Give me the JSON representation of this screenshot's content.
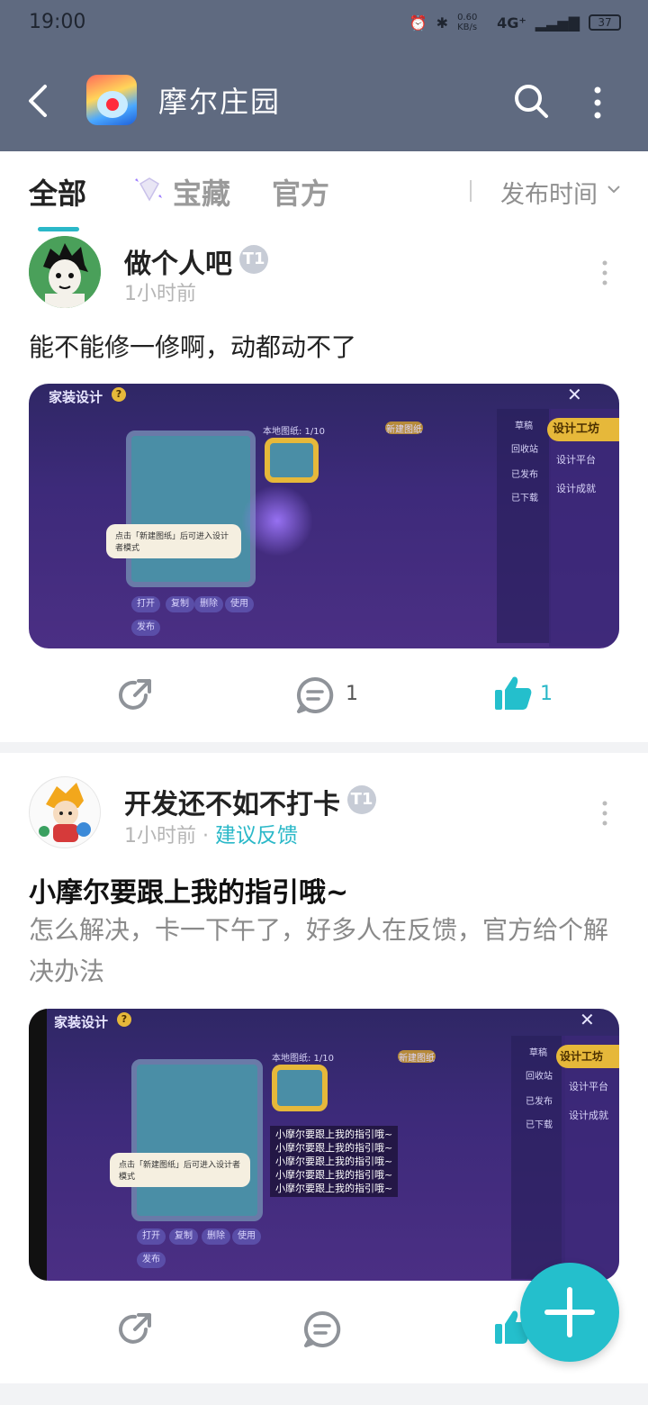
{
  "status_bar": {
    "time": "19:00",
    "net_speed": "0.60 KB/s",
    "signal": "4G⁺",
    "battery": "37"
  },
  "header": {
    "title": "摩尔庄园"
  },
  "tabs": {
    "all": "全部",
    "treasure": "宝藏",
    "official": "官方",
    "sort": "发布时间"
  },
  "posts": [
    {
      "user": "做个人吧",
      "badge": "T1",
      "time": "1小时前",
      "tag": "",
      "text": "能不能修一修啊，动都动不了",
      "image": {
        "title": "家装设计",
        "local_label": "本地图纸: 1/10",
        "new_label": "新建图纸",
        "tip": "点击「新建图纸」后可进入设计者模式",
        "side": [
          "草稿",
          "回收站",
          "已发布",
          "已下载"
        ],
        "menu": [
          "设计工坊",
          "设计平台",
          "设计成就"
        ],
        "buttons": [
          "打开",
          "复制",
          "删除",
          "使用",
          "发布"
        ],
        "spam": []
      },
      "comments": "1",
      "likes": "1"
    },
    {
      "user": "开发还不如不打卡",
      "badge": "T1",
      "time": "1小时前",
      "tag": "建议反馈",
      "title": "小摩尔要跟上我的指引哦~",
      "text": "怎么解决，卡一下午了，好多人在反馈，官方给个解决办法",
      "image": {
        "title": "家装设计",
        "local_label": "本地图纸: 1/10",
        "new_label": "新建图纸",
        "tip": "点击「新建图纸」后可进入设计者模式",
        "side": [
          "草稿",
          "回收站",
          "已发布",
          "已下载"
        ],
        "menu": [
          "设计工坊",
          "设计平台",
          "设计成就"
        ],
        "buttons": [
          "打开",
          "复制",
          "删除",
          "使用",
          "发布"
        ],
        "spam": [
          "小摩尔要跟上我的指引哦~",
          "小摩尔要跟上我的指引哦~",
          "小摩尔要跟上我的指引哦~",
          "小摩尔要跟上我的指引哦~",
          "小摩尔要跟上我的指引哦~"
        ]
      }
    }
  ],
  "colors": {
    "header_bg": "#5f6a80",
    "accent": "#2ab8c8",
    "fab": "#24bfcc"
  },
  "icons": [
    "back-arrow-icon",
    "search-icon",
    "more-vertical-icon",
    "diamond-icon",
    "share-icon",
    "comment-icon",
    "like-icon",
    "plus-icon"
  ]
}
